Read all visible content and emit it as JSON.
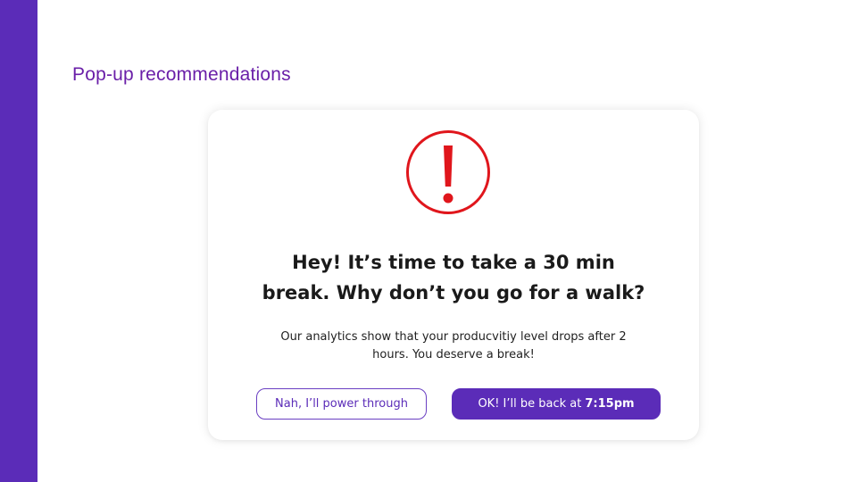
{
  "slide": {
    "title": "Pop-up recommendations"
  },
  "popup": {
    "icon": "exclamation-circle-icon",
    "headline_line1": "Hey! It’s time to take a 30 min",
    "headline_line2": "break. Why don’t you go for a walk?",
    "body_line1": "Our analytics show that your producvitiy level drops after 2",
    "body_line2": "hours. You deserve a break!",
    "decline_label": "Nah, I’ll power through",
    "accept_label": "OK! I’ll be back at",
    "accept_time": "7:15pm"
  },
  "colors": {
    "accent_purple": "#5b2cb8",
    "title_purple": "#6a1fa8",
    "alert_red": "#e0161c"
  }
}
